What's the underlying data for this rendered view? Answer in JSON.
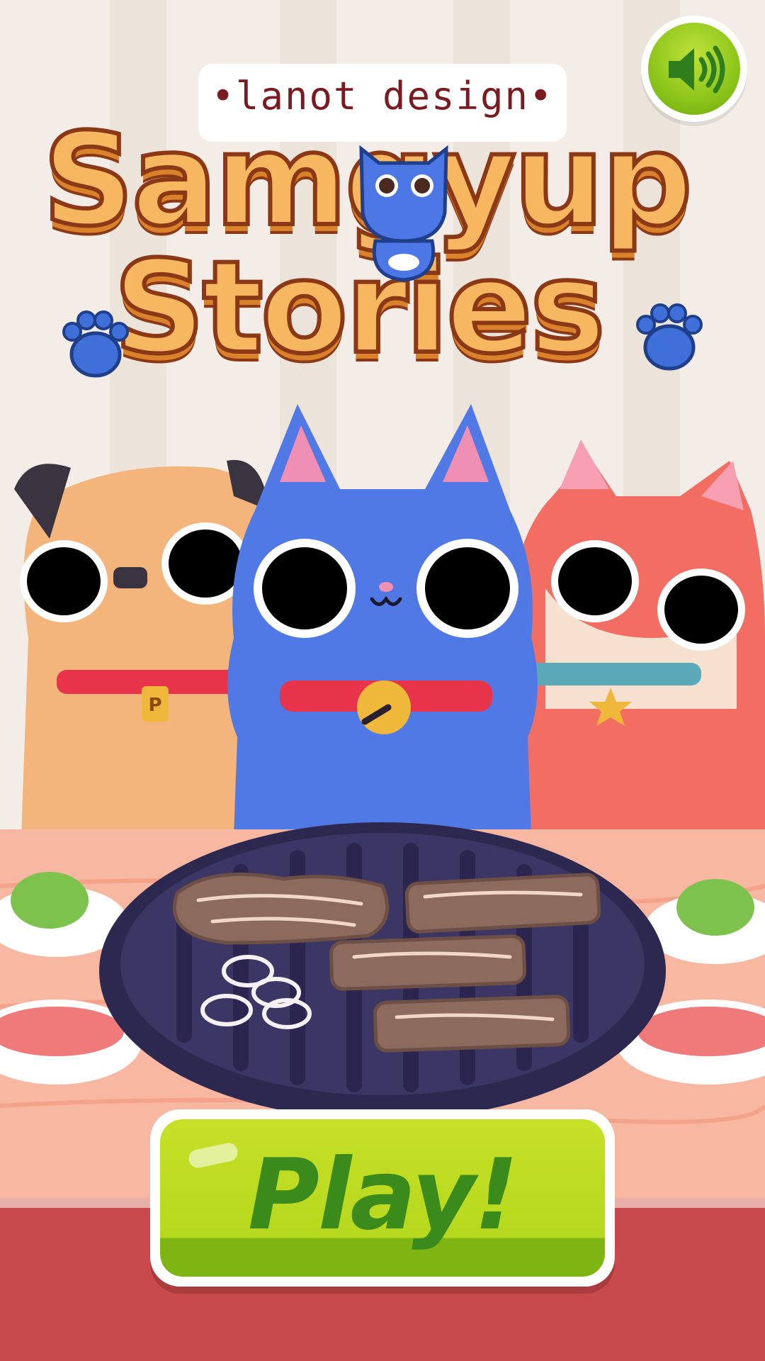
{
  "header": {
    "brand": "•lanot design•",
    "title_line_1": "Samgyup",
    "title_line_2": "Stories",
    "sound_icon": "speaker-volume-icon"
  },
  "characters": [
    {
      "name": "pug",
      "collar_tag": "P"
    },
    {
      "name": "blue-cat"
    },
    {
      "name": "red-fox"
    }
  ],
  "play_button": {
    "label": "Play!"
  },
  "colors": {
    "blue_cat": "#5079e6",
    "pug": "#f3b57b",
    "fox": "#f26d62",
    "grill": "#3c3664",
    "table": "#f6b29c",
    "play_green": "#b6d81d",
    "play_text": "#3b8a1c",
    "title_fill": "#f7b760",
    "title_stroke": "#8a3816"
  }
}
